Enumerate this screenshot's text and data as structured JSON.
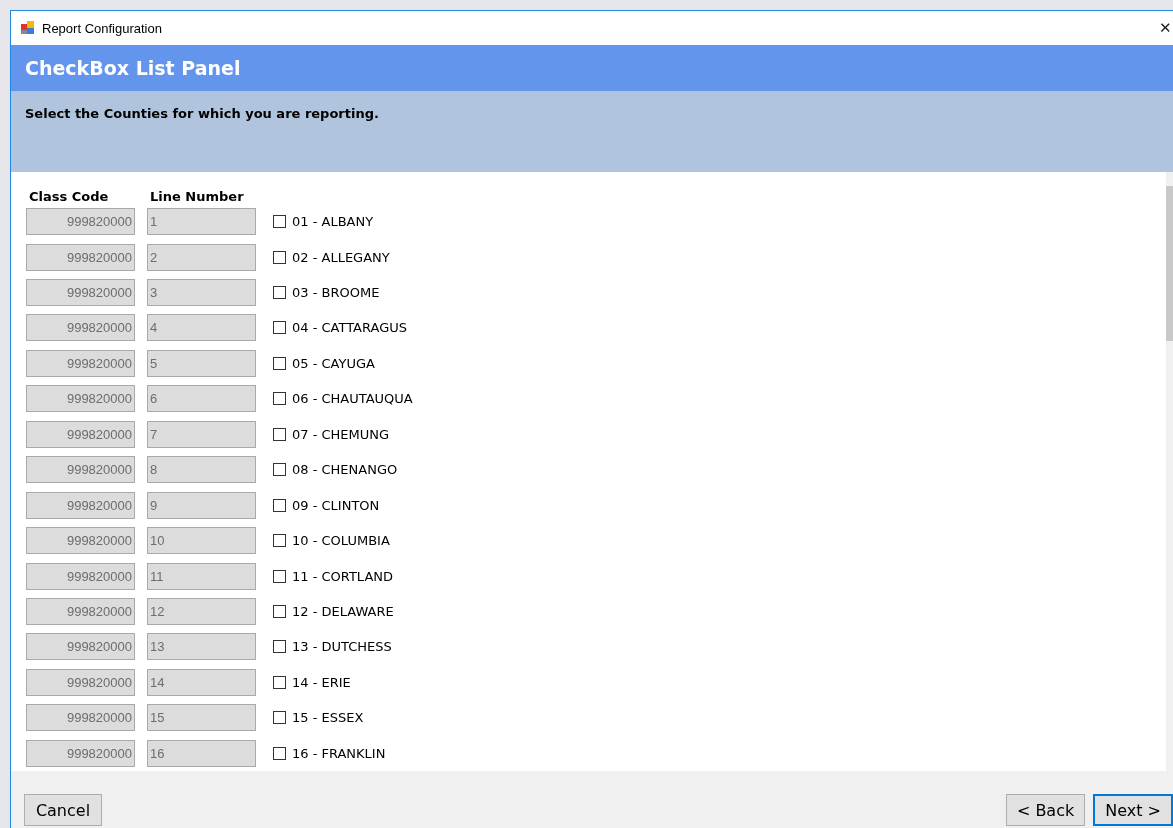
{
  "window": {
    "title": "Report Configuration",
    "close": "✕"
  },
  "header": {
    "title": "CheckBox List Panel"
  },
  "instructions": "Select the Counties for which you are reporting.",
  "columns": [
    "Class Code",
    "Line Number"
  ],
  "rows": [
    {
      "class_code": "999820000",
      "line_number": "1",
      "county": "01 - ALBANY",
      "checked": false
    },
    {
      "class_code": "999820000",
      "line_number": "2",
      "county": "02 - ALLEGANY",
      "checked": false
    },
    {
      "class_code": "999820000",
      "line_number": "3",
      "county": "03 - BROOME",
      "checked": false
    },
    {
      "class_code": "999820000",
      "line_number": "4",
      "county": "04 - CATTARAGUS",
      "checked": false
    },
    {
      "class_code": "999820000",
      "line_number": "5",
      "county": "05 - CAYUGA",
      "checked": false
    },
    {
      "class_code": "999820000",
      "line_number": "6",
      "county": "06 - CHAUTAUQUA",
      "checked": false
    },
    {
      "class_code": "999820000",
      "line_number": "7",
      "county": "07 - CHEMUNG",
      "checked": false
    },
    {
      "class_code": "999820000",
      "line_number": "8",
      "county": "08 - CHENANGO",
      "checked": false
    },
    {
      "class_code": "999820000",
      "line_number": "9",
      "county": "09 - CLINTON",
      "checked": false
    },
    {
      "class_code": "999820000",
      "line_number": "10",
      "county": "10 - COLUMBIA",
      "checked": false
    },
    {
      "class_code": "999820000",
      "line_number": "11",
      "county": "11 - CORTLAND",
      "checked": false
    },
    {
      "class_code": "999820000",
      "line_number": "12",
      "county": "12 - DELAWARE",
      "checked": false
    },
    {
      "class_code": "999820000",
      "line_number": "13",
      "county": "13 - DUTCHESS",
      "checked": false
    },
    {
      "class_code": "999820000",
      "line_number": "14",
      "county": "14 - ERIE",
      "checked": false
    },
    {
      "class_code": "999820000",
      "line_number": "15",
      "county": "15 - ESSEX",
      "checked": false
    },
    {
      "class_code": "999820000",
      "line_number": "16",
      "county": "16 - FRANKLIN",
      "checked": false
    }
  ],
  "footer": {
    "left_buttons": [
      {
        "label": "Cancel",
        "focused": false
      }
    ],
    "right_buttons": [
      {
        "label": "< Back",
        "focused": false
      },
      {
        "label": "Next >",
        "focused": true
      }
    ]
  }
}
